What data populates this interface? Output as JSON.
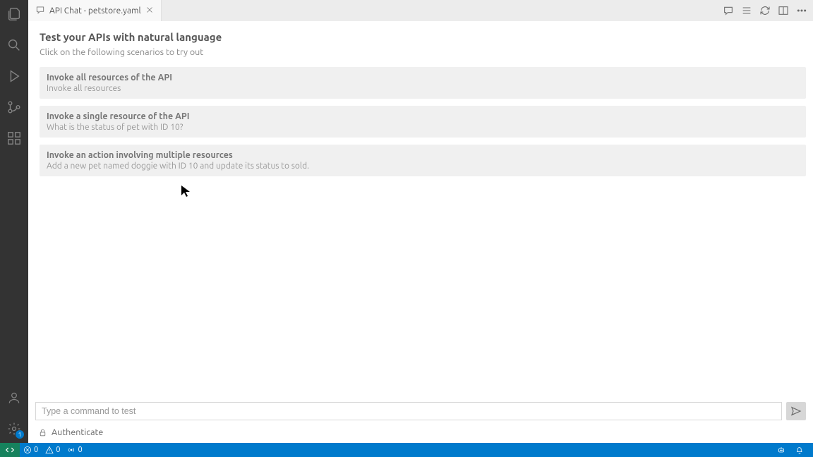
{
  "tab": {
    "title": "API Chat - petstore.yaml"
  },
  "header": {
    "title": "Test your APIs with natural language",
    "subtitle": "Click on the following scenarios to try out"
  },
  "scenarios": [
    {
      "title": "Invoke all resources of the API",
      "desc": "Invoke all resources"
    },
    {
      "title": "Invoke a single resource of the API",
      "desc": "What is the status of pet with ID 10?"
    },
    {
      "title": "Invoke an action involving multiple resources",
      "desc": "Add a new pet named doggie with ID 10 and update its status to sold."
    }
  ],
  "input": {
    "placeholder": "Type a command to test"
  },
  "auth": {
    "label": "Authenticate"
  },
  "status": {
    "errors": "0",
    "warnings": "0",
    "ports": "0"
  },
  "gear_badge": "1"
}
